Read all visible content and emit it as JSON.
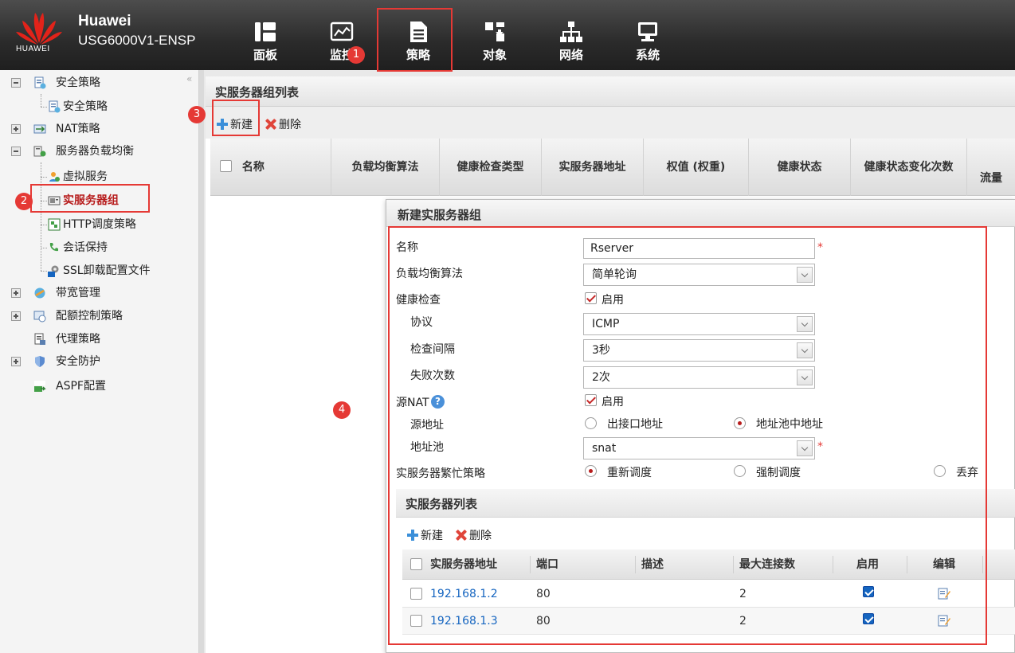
{
  "header": {
    "brand_name": "Huawei",
    "device_model": "USG6000V1-ENSP",
    "logo_text": "HUAWEI",
    "nav": [
      {
        "label": "面板",
        "icon": "dashboard-icon"
      },
      {
        "label": "监控",
        "icon": "monitor-chart-icon"
      },
      {
        "label": "策略",
        "icon": "policy-document-icon"
      },
      {
        "label": "对象",
        "icon": "object-icon"
      },
      {
        "label": "网络",
        "icon": "network-icon"
      },
      {
        "label": "系统",
        "icon": "system-computer-icon"
      }
    ],
    "active_nav": "策略"
  },
  "annotations": {
    "step1": "1",
    "step2": "2",
    "step3": "3",
    "step4": "4"
  },
  "sidebar": {
    "collapse_glyph": "«",
    "items": [
      {
        "label": "安全策略",
        "level": 0,
        "expander": "minus"
      },
      {
        "label": "安全策略",
        "level": 1
      },
      {
        "label": "NAT策略",
        "level": 0,
        "expander": "plus"
      },
      {
        "label": "服务器负载均衡",
        "level": 0,
        "expander": "minus"
      },
      {
        "label": "虚拟服务",
        "level": 1
      },
      {
        "label": "实服务器组",
        "level": 1,
        "selected": true
      },
      {
        "label": "HTTP调度策略",
        "level": 1
      },
      {
        "label": "会话保持",
        "level": 1
      },
      {
        "label": "SSL卸载配置文件",
        "level": 1
      },
      {
        "label": "带宽管理",
        "level": 0,
        "expander": "plus"
      },
      {
        "label": "配额控制策略",
        "level": 0,
        "expander": "plus"
      },
      {
        "label": "代理策略",
        "level": 0
      },
      {
        "label": "安全防护",
        "level": 0,
        "expander": "plus"
      },
      {
        "label": "ASPF配置",
        "level": 0
      }
    ]
  },
  "list_panel": {
    "title": "实服务器组列表",
    "new_label": "新建",
    "delete_label": "删除",
    "columns": [
      "名称",
      "负载均衡算法",
      "健康检查类型",
      "实服务器地址",
      "权值 (权重)",
      "健康状态",
      "健康状态变化次数",
      "流量"
    ]
  },
  "dialog": {
    "title": "新建实服务器组",
    "name_label": "名称",
    "name_value": "Rserver",
    "algorithm_label": "负载均衡算法",
    "algorithm_value": "简单轮询",
    "health_label": "健康检查",
    "health_enable_label": "启用",
    "protocol_label": "协议",
    "protocol_value": "ICMP",
    "interval_label": "检查间隔",
    "interval_value": "3秒",
    "failures_label": "失败次数",
    "failures_value": "2次",
    "snat_label": "源NAT",
    "snat_help": "?",
    "snat_enable_label": "启用",
    "src_addr_label": "源地址",
    "src_option_egress": "出接口地址",
    "src_option_pool": "地址池中地址",
    "pool_label": "地址池",
    "pool_value": "snat",
    "busy_label": "实服务器繁忙策略",
    "busy_reschedule": "重新调度",
    "busy_force": "强制调度",
    "busy_drop": "丢弃",
    "required_mark": "*"
  },
  "server_list": {
    "title": "实服务器列表",
    "new_label": "新建",
    "delete_label": "删除",
    "columns": [
      "实服务器地址",
      "端口",
      "描述",
      "最大连接数",
      "启用",
      "编辑"
    ],
    "rows": [
      {
        "address": "192.168.1.2",
        "port": "80",
        "description": "",
        "max_conn": "2",
        "enabled": true
      },
      {
        "address": "192.168.1.3",
        "port": "80",
        "description": "",
        "max_conn": "2",
        "enabled": true
      }
    ]
  },
  "colors": {
    "highlight": "#e53935",
    "link": "#1565c0",
    "topbar": "#2b2b2b"
  }
}
